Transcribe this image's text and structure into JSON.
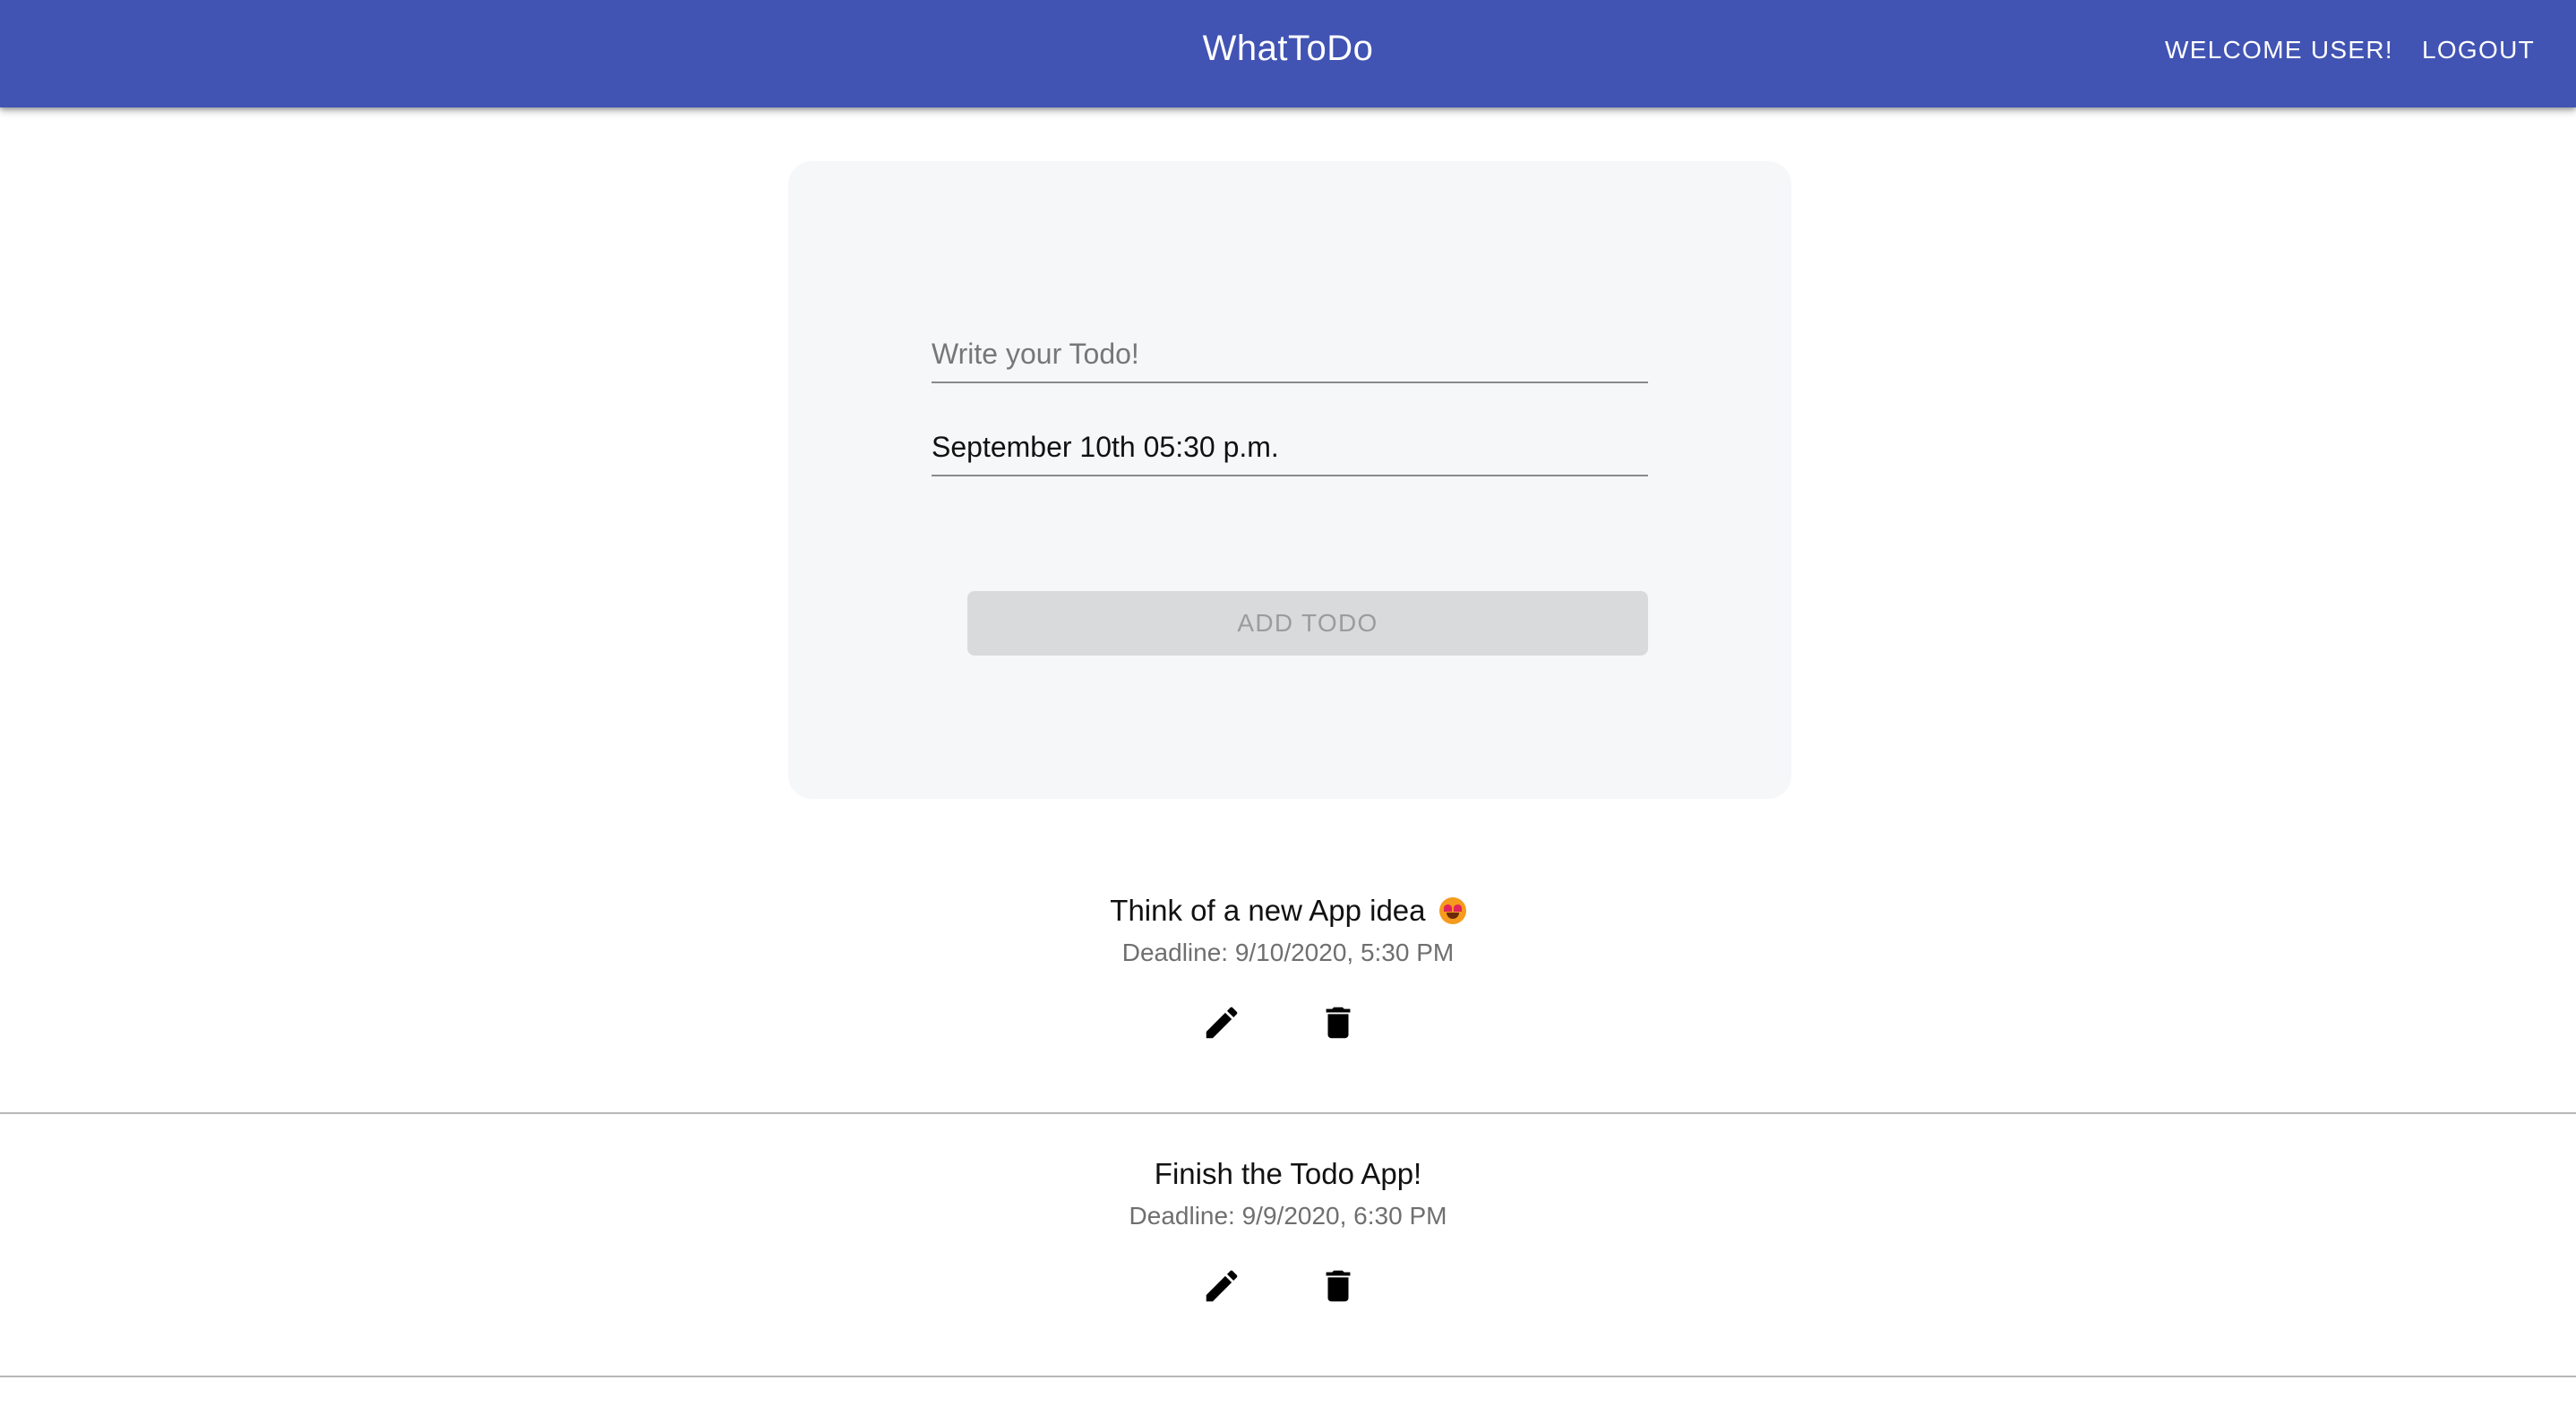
{
  "app_bar": {
    "title": "WhatToDo",
    "welcome_label": "WELCOME USER!",
    "logout_label": "LOGOUT",
    "color": "#4153b3"
  },
  "form": {
    "todo_input": {
      "placeholder": "Write your Todo!",
      "value": ""
    },
    "deadline_input": {
      "value": "September 10th 05:30 p.m."
    },
    "add_button_label": "ADD TODO",
    "add_button_state": "disabled"
  },
  "todos": [
    {
      "text": "Think of a new App idea",
      "emoji": "heart-eyes-emoji",
      "deadline": "Deadline: 9/10/2020, 5:30 PM",
      "edit_icon": "pencil-icon",
      "delete_icon": "trash-icon"
    },
    {
      "text": "Finish the Todo App!",
      "deadline": "Deadline: 9/9/2020, 6:30 PM",
      "edit_icon": "pencil-icon",
      "delete_icon": "trash-icon"
    }
  ]
}
